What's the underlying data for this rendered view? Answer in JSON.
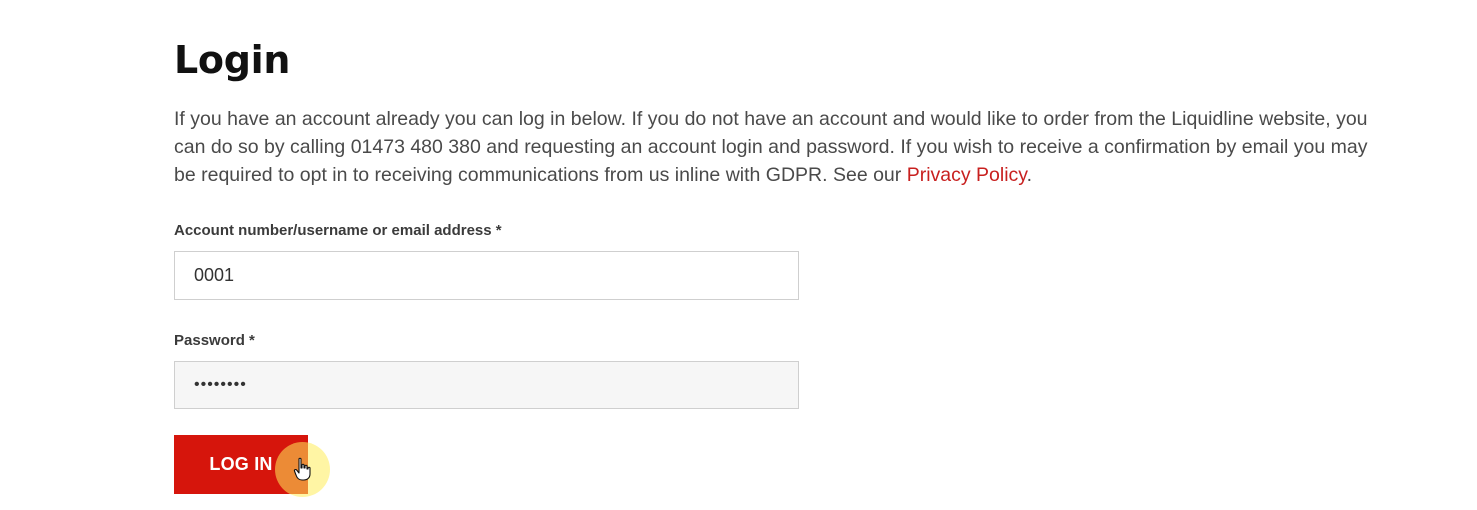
{
  "login": {
    "title": "Login",
    "intro_text": "If you have an account already you can log in below. If you do not have an account and would like to order from the Liquidline website, you can do so by calling 01473 480 380 and requesting an account login and password. If you wish to receive a confirmation by email you may be required to opt in to receiving communications from us inline with GDPR. See our ",
    "privacy_link": "Privacy Policy",
    "intro_end": ".",
    "username_label": "Account number/username or email address *",
    "username_value": "0001",
    "password_label": "Password *",
    "password_value": "password",
    "login_button": "LOG IN"
  },
  "colors": {
    "accent_red": "#d6150c",
    "link_red": "#c8201f",
    "cursor_highlight": "#ffec5a"
  },
  "icons": {
    "cursor": "hand-pointer-icon"
  }
}
